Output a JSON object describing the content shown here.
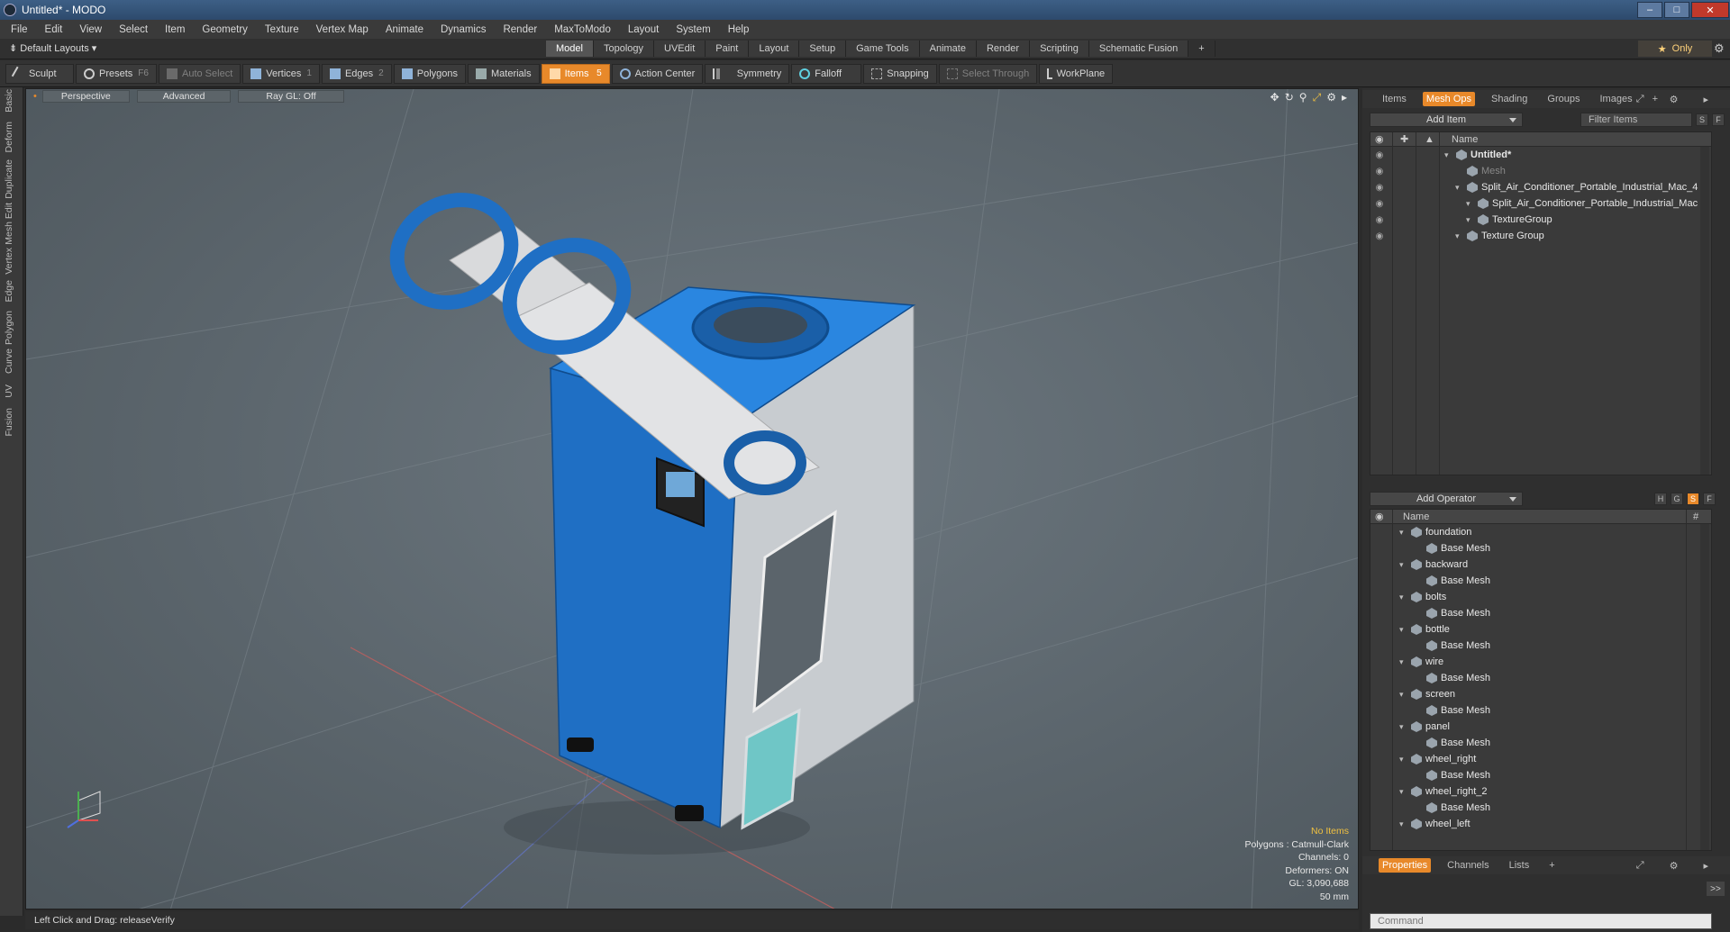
{
  "window": {
    "title": "Untitled* - MODO"
  },
  "menu": [
    "File",
    "Edit",
    "View",
    "Select",
    "Item",
    "Geometry",
    "Texture",
    "Vertex Map",
    "Animate",
    "Dynamics",
    "Render",
    "MaxToModo",
    "Layout",
    "System",
    "Help"
  ],
  "layout": {
    "default": "Default Layouts",
    "tabs": [
      "Model",
      "Topology",
      "UVEdit",
      "Paint",
      "Layout",
      "Setup",
      "Game Tools",
      "Animate",
      "Render",
      "Scripting",
      "Schematic Fusion"
    ],
    "active": "Model",
    "plus": "+",
    "only": "Only"
  },
  "toolbar": {
    "sculpt": "Sculpt",
    "presets": "Presets",
    "presets_key": "F6",
    "auto_select": "Auto Select",
    "vertices": "Vertices",
    "vertices_key": "1",
    "edges": "Edges",
    "edges_key": "2",
    "polygons": "Polygons",
    "materials": "Materials",
    "items": "Items",
    "items_key": "5",
    "action_center": "Action Center",
    "symmetry": "Symmetry",
    "falloff": "Falloff",
    "snapping": "Snapping",
    "select_through": "Select Through",
    "workplane": "WorkPlane"
  },
  "leftstrip": [
    "Basic",
    "Deform",
    "Duplicate",
    "Mesh Edit",
    "Vertex",
    "Edge",
    "Polygon",
    "Curve",
    "UV",
    "Fusion"
  ],
  "viewport": {
    "perspective": "Perspective",
    "advanced": "Advanced",
    "raygl": "Ray GL: Off",
    "info": {
      "no_items": "No Items",
      "polygons": "Polygons : Catmull-Clark",
      "channels": "Channels: 0",
      "deformers": "Deformers: ON",
      "gl": "GL: 3,090,688",
      "units": "50 mm"
    }
  },
  "status": {
    "text": "Left Click and Drag:  releaseVerify"
  },
  "items_panel": {
    "tabs": [
      "Items",
      "Mesh Ops",
      "Shading",
      "Groups",
      "Images",
      "+"
    ],
    "active": "Mesh Ops",
    "add_item": "Add Item",
    "filter": "Filter Items",
    "s": "S",
    "f": "F",
    "name_col": "Name",
    "tree": [
      {
        "label": "Untitled*",
        "indent": 0,
        "bold": true
      },
      {
        "label": "Mesh",
        "indent": 1,
        "dim": true
      },
      {
        "label": "Split_Air_Conditioner_Portable_Industrial_Mac_4 ...",
        "indent": 1
      },
      {
        "label": "Split_Air_Conditioner_Portable_Industrial_Mac ...",
        "indent": 2
      },
      {
        "label": "TextureGroup",
        "indent": 2
      },
      {
        "label": "Texture Group",
        "indent": 1
      }
    ]
  },
  "meshops_panel": {
    "add_operator": "Add Operator",
    "h": "H",
    "g": "G",
    "s": "S",
    "f": "F",
    "name_col": "Name",
    "hash_col": "#",
    "rows": [
      {
        "label": "foundation",
        "child": "Base Mesh"
      },
      {
        "label": "backward",
        "child": "Base Mesh"
      },
      {
        "label": "bolts",
        "child": "Base Mesh"
      },
      {
        "label": "bottle",
        "child": "Base Mesh"
      },
      {
        "label": "wire",
        "child": "Base Mesh"
      },
      {
        "label": "screen",
        "child": "Base Mesh"
      },
      {
        "label": "panel",
        "child": "Base Mesh"
      },
      {
        "label": "wheel_right",
        "child": "Base Mesh"
      },
      {
        "label": "wheel_right_2",
        "child": "Base Mesh"
      },
      {
        "label": "wheel_left",
        "child": ""
      }
    ]
  },
  "properties": {
    "tabs": [
      "Properties",
      "Channels",
      "Lists",
      "+"
    ],
    "active": "Properties",
    "command": "Command",
    "expand": ">>"
  },
  "colors": {
    "accent": "#e8892a",
    "product_blue": "#1f6fc4"
  }
}
